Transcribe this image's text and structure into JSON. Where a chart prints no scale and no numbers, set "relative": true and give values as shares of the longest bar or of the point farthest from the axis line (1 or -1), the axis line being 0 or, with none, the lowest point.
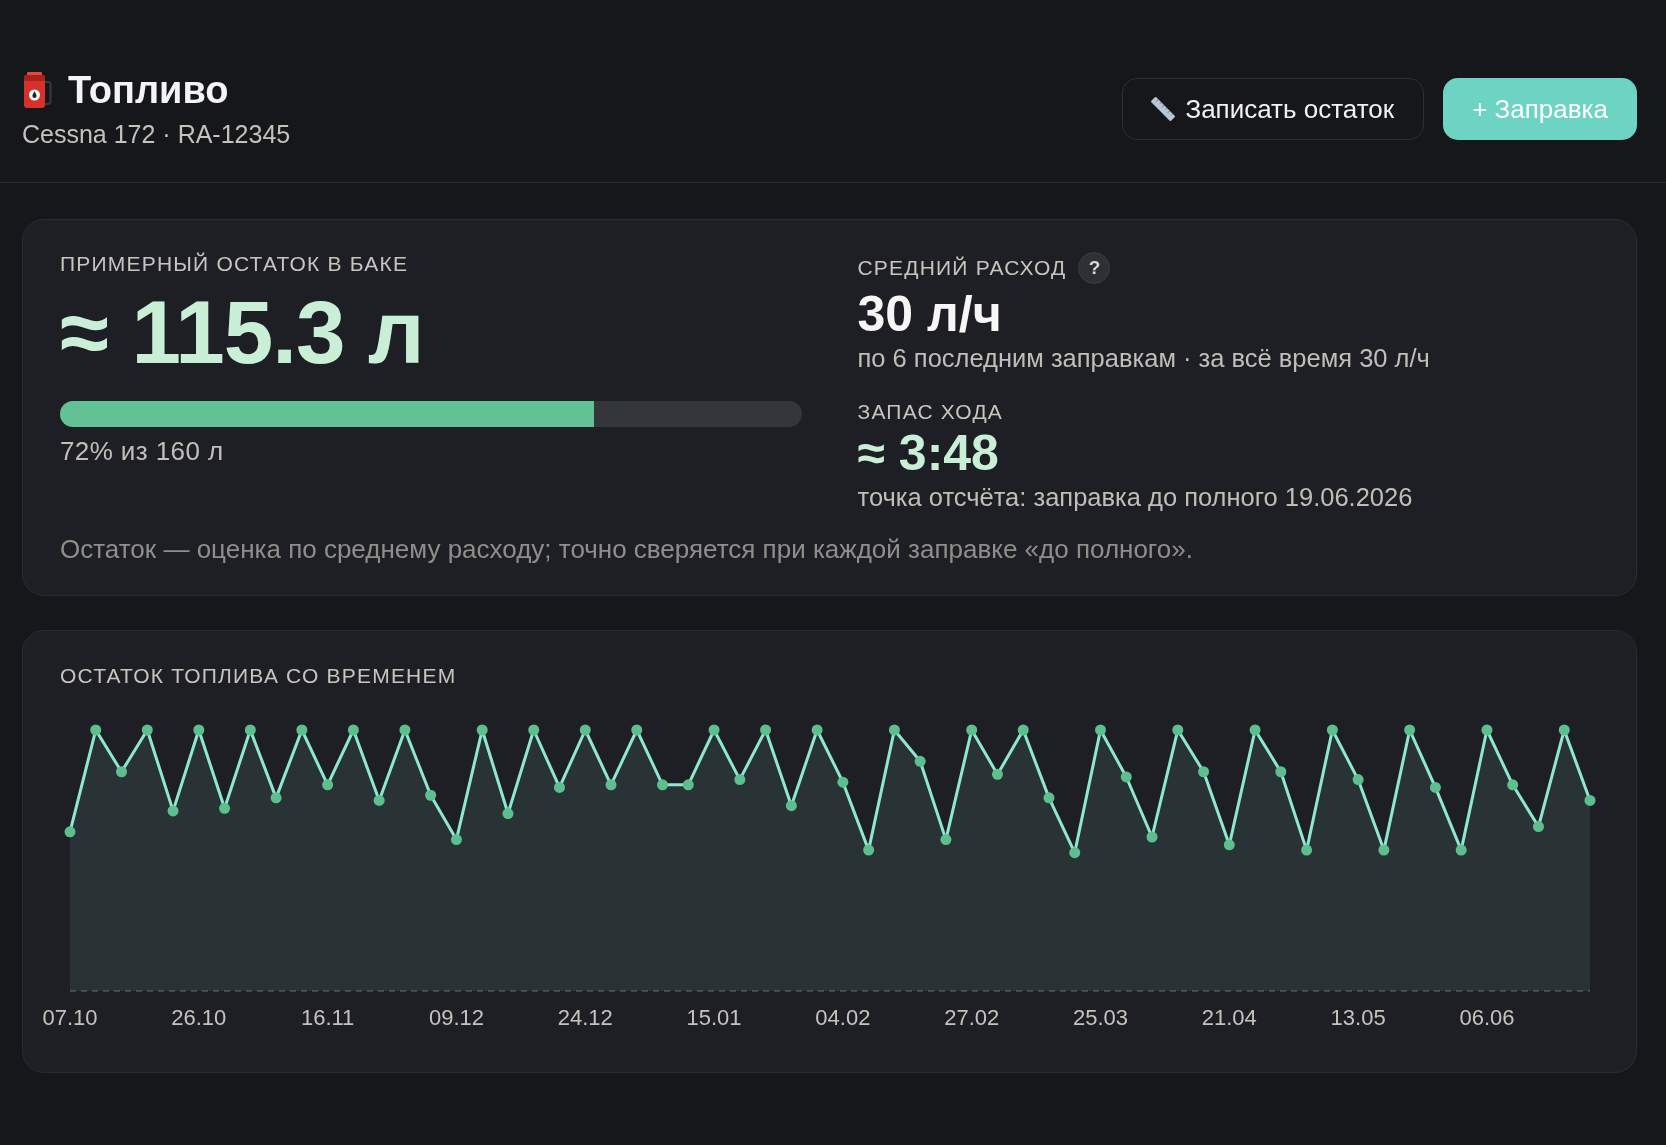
{
  "header": {
    "title": "Топливо",
    "subtitle": "Cessna 172 · RA-12345",
    "buttons": [
      {
        "kind": "secondary",
        "label": "Записать остаток"
      },
      {
        "kind": "primary",
        "label": "+ Заправка"
      }
    ]
  },
  "summary": {
    "remaining": {
      "label": "ПРИМЕРНЫЙ ОСТАТОК В БАКЕ",
      "value": "≈ 115.3 л",
      "level": 0.72,
      "caption": "72% из 160 л"
    },
    "consumption": {
      "label": "СРЕДНИЙ РАСХОД",
      "help": "?",
      "value": "30 л/ч",
      "caption": "по 6 последним заправкам · за всё время 30 л/ч"
    },
    "range": {
      "label": "ЗАПАС ХОДА",
      "value": "≈ 3:48",
      "caption": "точка отсчёта: заправка до полного 19.06.2026"
    },
    "note": "Остаток — оценка по среднему расходу; точно сверяется при каждой заправке «до полного»."
  },
  "history": {
    "chart_data": {
      "type": "area",
      "title": "ОСТАТОК ТОПЛИВА СО ВРЕМЕНЕМ",
      "relative": true,
      "categories": [
        "07.10",
        null,
        null,
        null,
        null,
        "26.10",
        null,
        null,
        null,
        null,
        "16.11",
        null,
        null,
        null,
        null,
        "09.12",
        null,
        null,
        null,
        null,
        "24.12",
        null,
        null,
        null,
        null,
        "15.01",
        null,
        null,
        null,
        null,
        "04.02",
        null,
        null,
        null,
        null,
        "27.02",
        null,
        null,
        null,
        null,
        "25.03",
        null,
        null,
        null,
        null,
        "21.04",
        null,
        null,
        null,
        null,
        "13.05",
        null,
        null,
        null,
        null,
        "06.06",
        null,
        null,
        null,
        null
      ],
      "series": [
        {
          "color": "#8fe7cf",
          "values": [
            0.61,
            1,
            0.84,
            1,
            0.69,
            1,
            0.7,
            1,
            0.74,
            1,
            0.79,
            1,
            0.73,
            1,
            0.75,
            0.58,
            1,
            0.68,
            1,
            0.78,
            1,
            0.79,
            1,
            0.79,
            0.79,
            1,
            0.81,
            1,
            0.71,
            1,
            0.8,
            0.54,
            1,
            0.88,
            0.58,
            1,
            0.83,
            1,
            0.74,
            0.53,
            1,
            0.82,
            0.59,
            1,
            0.84,
            0.56,
            1,
            0.84,
            0.54,
            1,
            0.81,
            0.54,
            1,
            0.78,
            0.54,
            1,
            0.79,
            0.63,
            1,
            0.73
          ]
        }
      ]
    }
  }
}
